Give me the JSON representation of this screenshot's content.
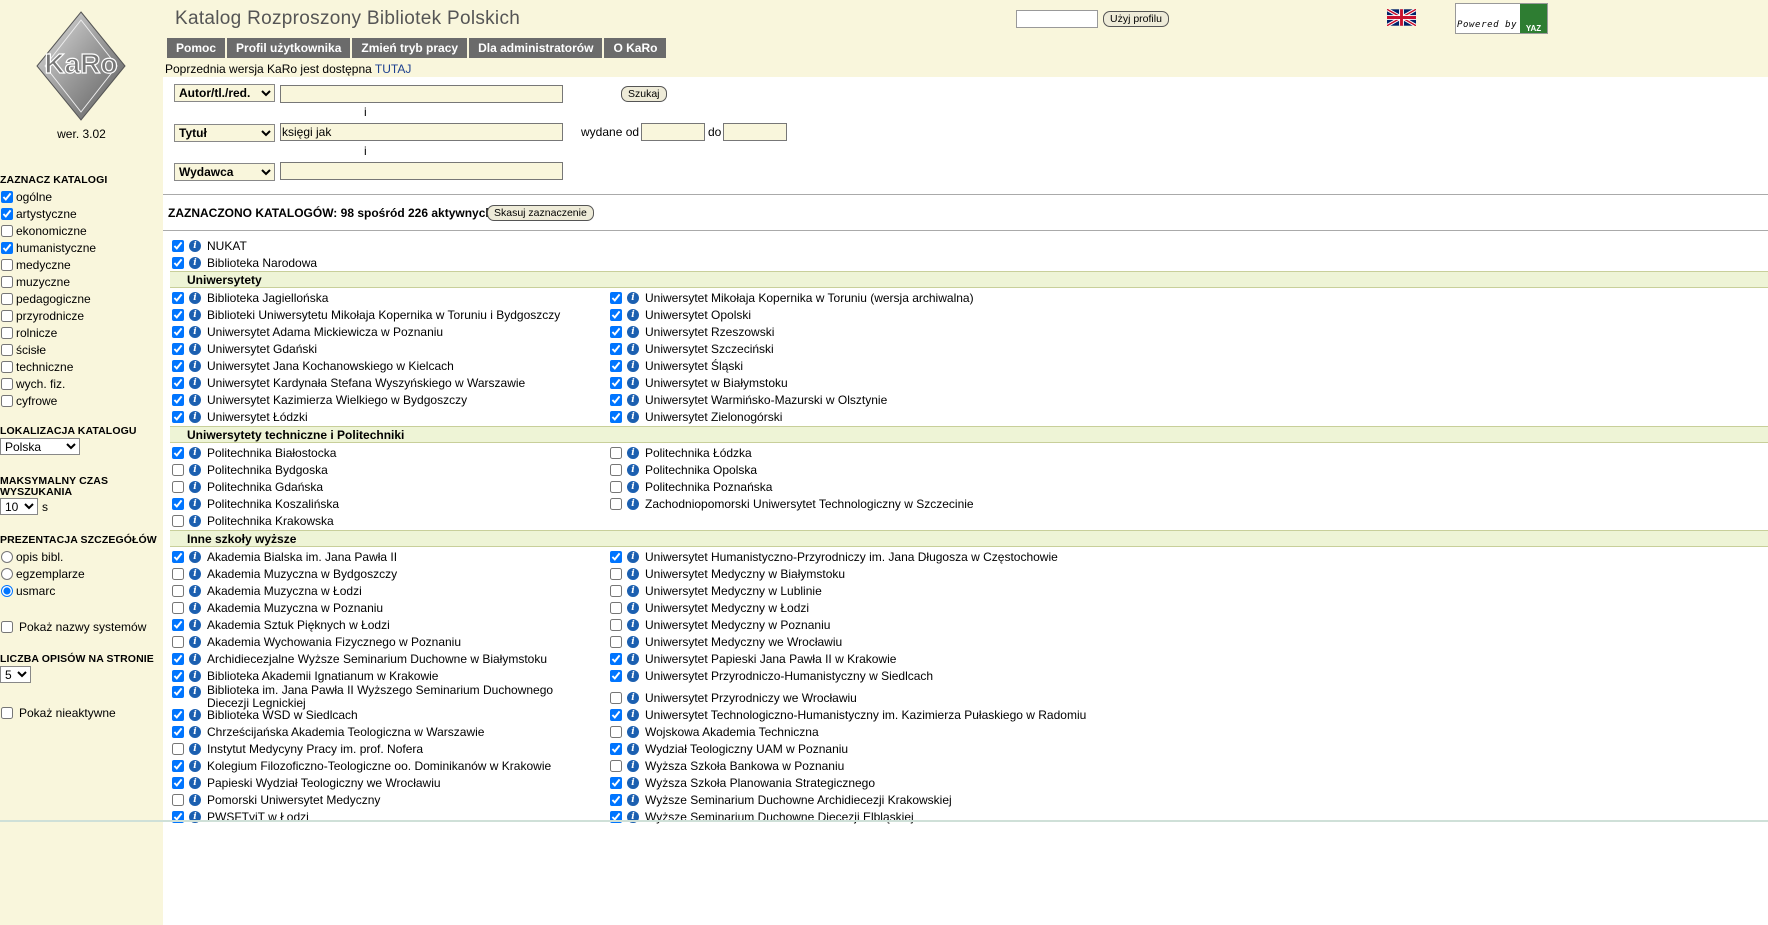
{
  "app": {
    "title": "Katalog Rozproszony Bibliotek Polskich",
    "logo_text": "KaRo",
    "version": "wer. 3.02",
    "prev_version_text": "Poprzednia wersja KaRo jest dostępna",
    "prev_version_link": "TUTAJ",
    "profile_button": "Użyj profilu",
    "powered_by": "Powered by",
    "powered_logo": "YAZ",
    "flag_icon": "uk-flag-icon"
  },
  "menu": [
    "Pomoc",
    "Profil użytkownika",
    "Zmień tryb pracy",
    "Dla administratorów",
    "O KaRo"
  ],
  "sidebar": {
    "catalog_heading": "ZAZNACZ KATALOGI",
    "catalog_types": [
      {
        "label": "ogólne",
        "checked": true
      },
      {
        "label": "artystyczne",
        "checked": true
      },
      {
        "label": "ekonomiczne",
        "checked": false
      },
      {
        "label": "humanistyczne",
        "checked": true
      },
      {
        "label": "medyczne",
        "checked": false
      },
      {
        "label": "muzyczne",
        "checked": false
      },
      {
        "label": "pedagogiczne",
        "checked": false
      },
      {
        "label": "przyrodnicze",
        "checked": false
      },
      {
        "label": "rolnicze",
        "checked": false
      },
      {
        "label": "ścisłe",
        "checked": false
      },
      {
        "label": "techniczne",
        "checked": false
      },
      {
        "label": "wych. fiz.",
        "checked": false
      },
      {
        "label": "cyfrowe",
        "checked": false
      }
    ],
    "location_heading": "LOKALIZACJA KATALOGU",
    "location_value": "Polska",
    "time_heading_1": "MAKSYMALNY CZAS",
    "time_heading_2": "WYSZUKANIA",
    "time_value": "10",
    "time_unit": "s",
    "details_heading": "PREZENTACJA SZCZEGÓŁÓW",
    "details_options": [
      {
        "label": "opis bibl.",
        "checked": false
      },
      {
        "label": "egzemplarze",
        "checked": false
      },
      {
        "label": "usmarc",
        "checked": true
      }
    ],
    "show_systems_label": "Pokaż nazwy systemów",
    "per_page_heading": "LICZBA OPISÓW NA STRONIE",
    "per_page_value": "5",
    "show_inactive_label": "Pokaż nieaktywne"
  },
  "search": {
    "rows": [
      {
        "field": "Autor/tl./red.",
        "value": ""
      },
      {
        "field": "Tytuł",
        "value": "księgi jak"
      },
      {
        "field": "Wydawca",
        "value": ""
      }
    ],
    "operator": "i",
    "search_button": "Szukaj",
    "published_from_label": "wydane od",
    "published_to_label": "do",
    "published_from": "",
    "published_to": ""
  },
  "selection": {
    "label": "ZAZNACZONO KATALOGÓW: 98 spośród 226 aktywnych",
    "clear_button": "Skasuj zaznaczenie"
  },
  "top_catalogs": [
    {
      "name": "NUKAT",
      "checked": true
    },
    {
      "name": "Biblioteka Narodowa",
      "checked": true
    }
  ],
  "sections": [
    {
      "title": "Uniwersytety",
      "left": [
        {
          "name": "Biblioteka Jagiellońska",
          "checked": true
        },
        {
          "name": "Biblioteki Uniwersytetu Mikołaja Kopernika w Toruniu i Bydgoszczy",
          "checked": true
        },
        {
          "name": "Uniwersytet Adama Mickiewicza w Poznaniu",
          "checked": true
        },
        {
          "name": "Uniwersytet Gdański",
          "checked": true
        },
        {
          "name": "Uniwersytet Jana Kochanowskiego w Kielcach",
          "checked": true
        },
        {
          "name": "Uniwersytet Kardynała Stefana Wyszyńskiego w Warszawie",
          "checked": true
        },
        {
          "name": "Uniwersytet Kazimierza Wielkiego w Bydgoszczy",
          "checked": true
        },
        {
          "name": "Uniwersytet Łódzki",
          "checked": true
        }
      ],
      "right": [
        {
          "name": "Uniwersytet Mikołaja Kopernika w Toruniu (wersja archiwalna)",
          "checked": true
        },
        {
          "name": "Uniwersytet Opolski",
          "checked": true
        },
        {
          "name": "Uniwersytet Rzeszowski",
          "checked": true
        },
        {
          "name": "Uniwersytet Szczeciński",
          "checked": true
        },
        {
          "name": "Uniwersytet Śląski",
          "checked": true
        },
        {
          "name": "Uniwersytet w Białymstoku",
          "checked": true
        },
        {
          "name": "Uniwersytet Warmińsko-Mazurski w Olsztynie",
          "checked": true
        },
        {
          "name": "Uniwersytet Zielonogórski",
          "checked": true
        }
      ]
    },
    {
      "title": "Uniwersytety techniczne i Politechniki",
      "left": [
        {
          "name": "Politechnika Białostocka",
          "checked": true
        },
        {
          "name": "Politechnika Bydgoska",
          "checked": false
        },
        {
          "name": "Politechnika Gdańska",
          "checked": false
        },
        {
          "name": "Politechnika Koszalińska",
          "checked": true
        },
        {
          "name": "Politechnika Krakowska",
          "checked": false
        }
      ],
      "right": [
        {
          "name": "Politechnika Łódzka",
          "checked": false
        },
        {
          "name": "Politechnika Opolska",
          "checked": false
        },
        {
          "name": "Politechnika Poznańska",
          "checked": false
        },
        {
          "name": "Zachodniopomorski Uniwersytet Technologiczny w Szczecinie",
          "checked": false
        }
      ]
    },
    {
      "title": "Inne szkoły wyższe",
      "left": [
        {
          "name": "Akademia Bialska im. Jana Pawła II",
          "checked": true
        },
        {
          "name": "Akademia Muzyczna w Bydgoszczy",
          "checked": false
        },
        {
          "name": "Akademia Muzyczna w Łodzi",
          "checked": false
        },
        {
          "name": "Akademia Muzyczna w Poznaniu",
          "checked": false
        },
        {
          "name": "Akademia Sztuk Pięknych w Łodzi",
          "checked": true
        },
        {
          "name": "Akademia Wychowania Fizycznego w Poznaniu",
          "checked": false
        },
        {
          "name": "Archidiecezjalne Wyższe Seminarium Duchowne w Białymstoku",
          "checked": true
        },
        {
          "name": "Biblioteka Akademii Ignatianum w Krakowie",
          "checked": true
        },
        {
          "name": "Biblioteka im. Jana Pawła II Wyższego Seminarium Duchownego Diecezji Legnickiej",
          "checked": true
        },
        {
          "name": "Biblioteka WSD w Siedlcach",
          "checked": true
        },
        {
          "name": "Chrześcijańska Akademia Teologiczna w Warszawie",
          "checked": true
        },
        {
          "name": "Instytut Medycyny Pracy im. prof. Nofera",
          "checked": false
        },
        {
          "name": "Kolegium Filozoficzno-Teologiczne oo. Dominikanów w Krakowie",
          "checked": true
        },
        {
          "name": "Papieski Wydział Teologiczny we Wrocławiu",
          "checked": true
        },
        {
          "name": "Pomorski Uniwersytet Medyczny",
          "checked": false
        },
        {
          "name": "PWSFTviT w Łodzi",
          "checked": true
        }
      ],
      "right": [
        {
          "name": "Uniwersytet Humanistyczno-Przyrodniczy im. Jana Długosza w Częstochowie",
          "checked": true
        },
        {
          "name": "Uniwersytet Medyczny w Białymstoku",
          "checked": false
        },
        {
          "name": "Uniwersytet Medyczny w Lublinie",
          "checked": false
        },
        {
          "name": "Uniwersytet Medyczny w Łodzi",
          "checked": false
        },
        {
          "name": "Uniwersytet Medyczny w Poznaniu",
          "checked": false
        },
        {
          "name": "Uniwersytet Medyczny we Wrocławiu",
          "checked": false
        },
        {
          "name": "Uniwersytet Papieski Jana Pawła II w Krakowie",
          "checked": true
        },
        {
          "name": "Uniwersytet Przyrodniczo-Humanistyczny w Siedlcach",
          "checked": true
        },
        {
          "name": "Uniwersytet Przyrodniczy we Wrocławiu",
          "checked": false
        },
        {
          "name": "Uniwersytet Technologiczno-Humanistyczny im. Kazimierza Pułaskiego w Radomiu",
          "checked": true
        },
        {
          "name": "Wojskowa Akademia Techniczna",
          "checked": false
        },
        {
          "name": "Wydział Teologiczny UAM w Poznaniu",
          "checked": true
        },
        {
          "name": "Wyższa Szkoła Bankowa w Poznaniu",
          "checked": false
        },
        {
          "name": "Wyższa Szkoła Planowania Strategicznego",
          "checked": true
        },
        {
          "name": "Wyższe Seminarium Duchowne Archidiecezji Krakowskiej",
          "checked": true
        },
        {
          "name": "Wyższe Seminarium Duchowne Diecezji Elbląskiej",
          "checked": true
        }
      ]
    }
  ],
  "colors": {
    "cream": "#f9f6dc",
    "menu_bg": "#6b6b6b",
    "section_bg": "#eef4d6",
    "info_icon": "#1b5fb0"
  }
}
